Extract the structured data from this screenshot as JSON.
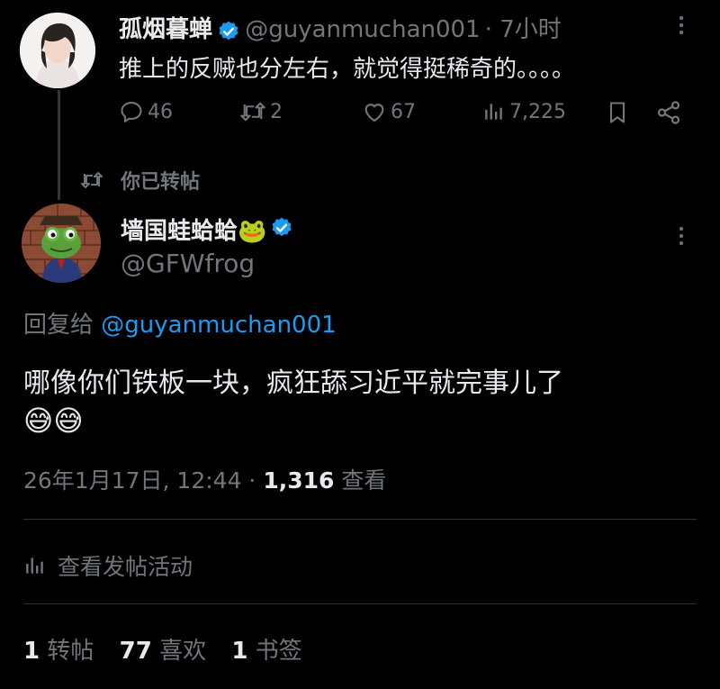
{
  "quoted": {
    "name": "孤烟暮蝉",
    "handle": "@guyanmuchan001",
    "time": "· 7小时",
    "text": "推上的反贼也分左右，就觉得挺稀奇的。。。。",
    "replies": "46",
    "retweets": "2",
    "likes": "67",
    "views": "7,225"
  },
  "repost_label": "你已转帖",
  "tweet": {
    "name": "墙国蛙蛤蛤🐸",
    "handle": "@GFWfrog",
    "reply_prefix": "回复给",
    "reply_to": "@guyanmuchan001",
    "text": "哪像你们铁板一块，疯狂舔习近平就完事儿了",
    "emoji": "😅😅",
    "timestamp": "26年1月17日, 12:44 ·",
    "view_count": "1,316",
    "view_label": "查看"
  },
  "activity_label": "查看发帖活动",
  "stats": {
    "retweets_num": "1",
    "retweets_lbl": "转帖",
    "likes_num": "77",
    "likes_lbl": "喜欢",
    "bookmarks_num": "1",
    "bookmarks_lbl": "书签"
  },
  "colors": {
    "background": "#000000",
    "text": "#e7e9ea",
    "muted": "#71767b",
    "link": "#1d9bf0",
    "verified": "#1d9bf0"
  }
}
